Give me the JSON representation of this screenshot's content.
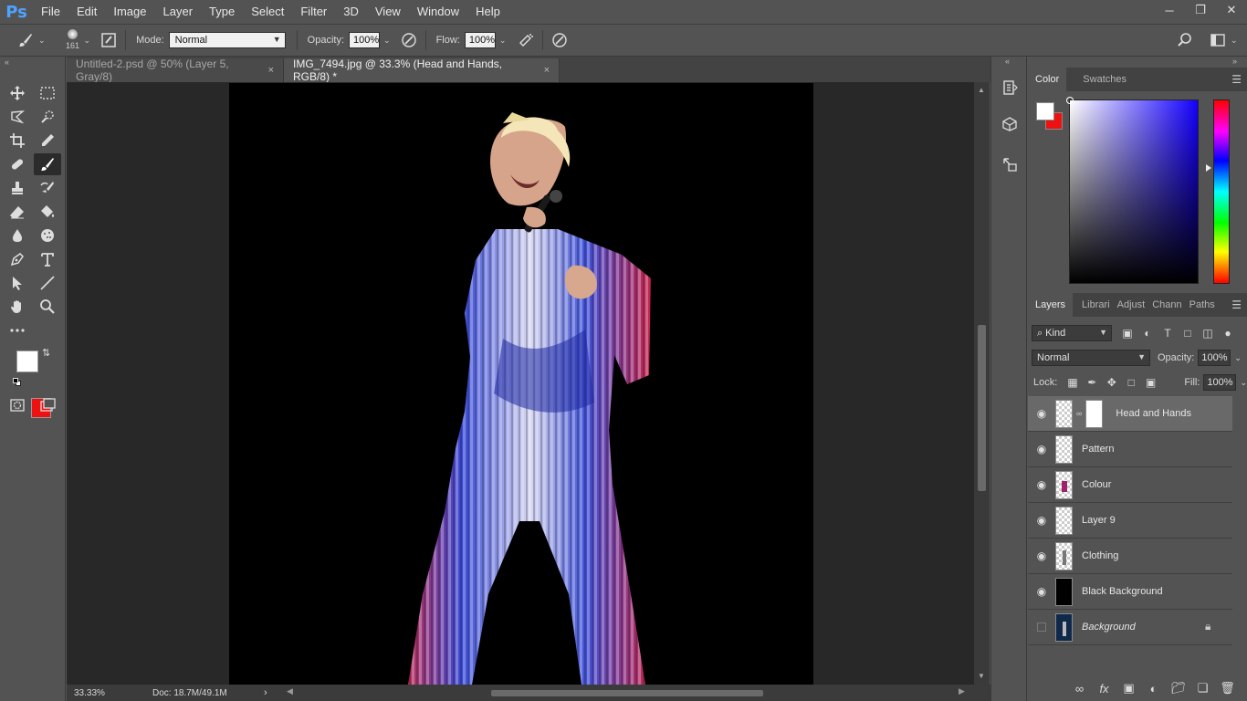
{
  "app": {
    "logo": "Ps"
  },
  "menu": [
    "File",
    "Edit",
    "Image",
    "Layer",
    "Type",
    "Select",
    "Filter",
    "3D",
    "View",
    "Window",
    "Help"
  ],
  "options": {
    "brush_size": "161",
    "mode_label": "Mode:",
    "mode_value": "Normal",
    "opacity_label": "Opacity:",
    "opacity_value": "100%",
    "flow_label": "Flow:",
    "flow_value": "100%"
  },
  "tabs": [
    {
      "label": "Untitled-2.psd @ 50% (Layer 5, Gray/8)",
      "close": "×"
    },
    {
      "label": "IMG_7494.jpg @ 33.3% (Head and Hands, RGB/8) *",
      "close": "×"
    }
  ],
  "status": {
    "zoom": "33.33%",
    "doc": "Doc: 18.7M/49.1M",
    "arrow": "›"
  },
  "color_panel": {
    "tabs": [
      "Color",
      "Swatches"
    ],
    "foreground": "#ffffff",
    "background": "#ee1111"
  },
  "layers_panel": {
    "tabs": [
      "Layers",
      "Librari",
      "Adjust",
      "Chann",
      "Paths"
    ],
    "filter_kind": "Kind",
    "blend_mode": "Normal",
    "opacity_label": "Opacity:",
    "opacity_value": "100%",
    "lock_label": "Lock:",
    "fill_label": "Fill:",
    "fill_value": "100%",
    "layers": [
      {
        "name": "Head and Hands",
        "visible": true,
        "selected": true
      },
      {
        "name": "Pattern",
        "visible": true
      },
      {
        "name": "Colour",
        "visible": true
      },
      {
        "name": "Layer 9",
        "visible": true
      },
      {
        "name": "Clothing",
        "visible": true
      },
      {
        "name": "Black Background",
        "visible": true
      },
      {
        "name": "Background",
        "visible": false,
        "locked": true
      }
    ]
  },
  "icons": {
    "accent": "#4da3ff",
    "foreground_swatch": "#ffffff",
    "background_swatch": "#ee1111"
  }
}
